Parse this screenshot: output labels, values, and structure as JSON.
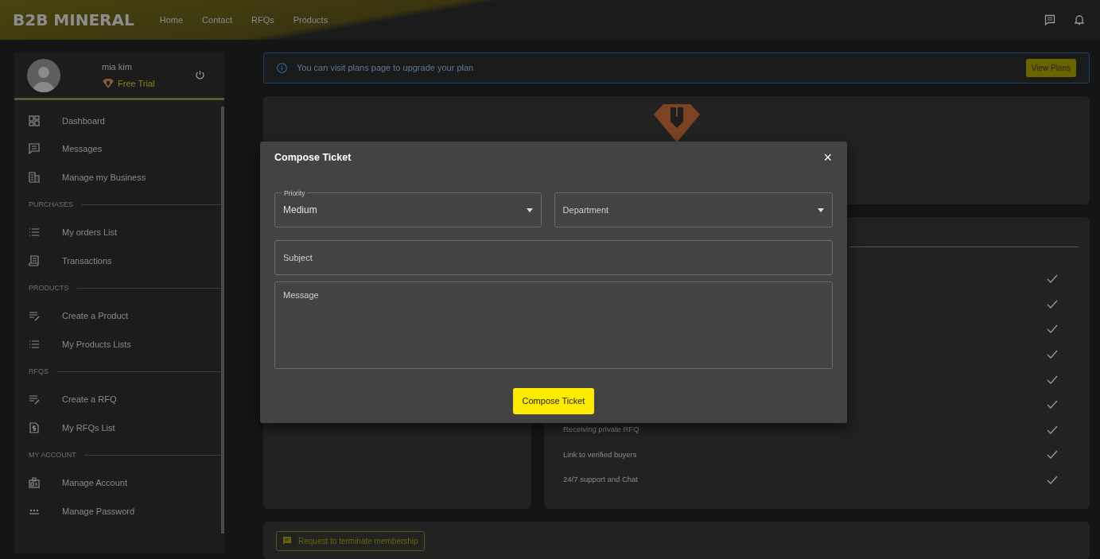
{
  "navbar": {
    "logo": "B2B MINERAL",
    "links": [
      "Home",
      "Contact",
      "RFQs",
      "Products"
    ]
  },
  "user": {
    "name": "mia kim",
    "plan": "Free Trial"
  },
  "sidebar": {
    "items": [
      {
        "kind": "link",
        "label": "Dashboard"
      },
      {
        "kind": "link",
        "label": "Messages"
      },
      {
        "kind": "link",
        "label": "Manage my Business"
      },
      {
        "kind": "section",
        "label": "PURCHASES"
      },
      {
        "kind": "link",
        "label": "My orders List"
      },
      {
        "kind": "link",
        "label": "Transactions"
      },
      {
        "kind": "section",
        "label": "PRODUCTS"
      },
      {
        "kind": "link",
        "label": "Create a Product"
      },
      {
        "kind": "link",
        "label": "My Products Lists"
      },
      {
        "kind": "section",
        "label": "RFQS"
      },
      {
        "kind": "link",
        "label": "Create a RFQ"
      },
      {
        "kind": "link",
        "label": "My RFQs List"
      },
      {
        "kind": "section",
        "label": "MY ACCOUNT"
      },
      {
        "kind": "link",
        "label": "Manage Account"
      },
      {
        "kind": "link",
        "label": "Manage Password"
      }
    ]
  },
  "alert": {
    "text": "You can visit plans page to upgrade your plan",
    "button": "View Plans"
  },
  "features": [
    {
      "kind": "hidden"
    },
    {
      "kind": "hidden"
    },
    {
      "kind": "hidden"
    },
    {
      "kind": "hidden"
    },
    {
      "kind": "hidden"
    },
    {
      "kind": "hidden"
    },
    {
      "kind": "text",
      "label": "Receiving private RFQ"
    },
    {
      "kind": "text",
      "label": "Link to verified buyers"
    },
    {
      "kind": "text",
      "label": "24/7 support and Chat"
    }
  ],
  "terminate_button": "Request to terminate membership",
  "modal": {
    "title": "Compose Ticket",
    "close": "×",
    "priority": {
      "label": "Priority",
      "value": "Medium"
    },
    "department": {
      "placeholder": "Department"
    },
    "subject": {
      "placeholder": "Subject"
    },
    "message": {
      "placeholder": "Message"
    },
    "submit": "Compose Ticket"
  }
}
